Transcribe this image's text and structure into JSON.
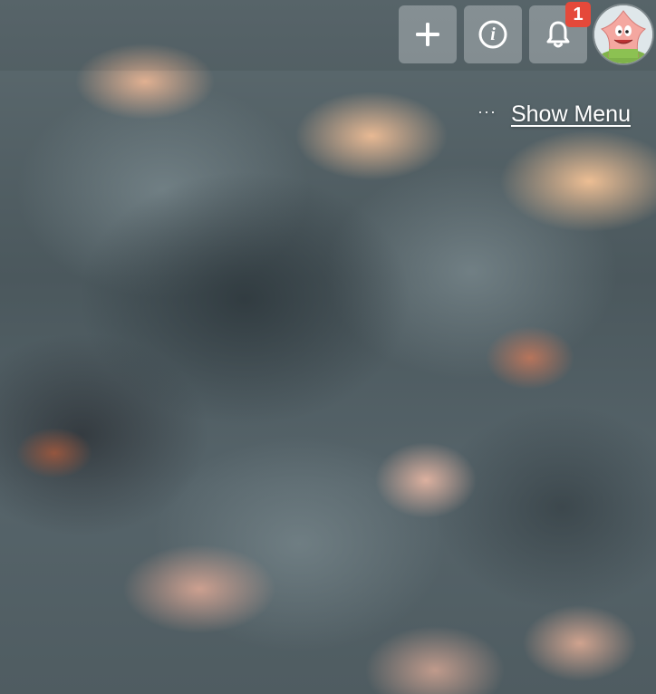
{
  "header": {
    "add_button": {
      "icon": "plus-icon"
    },
    "info_button": {
      "icon": "info-icon",
      "glyph": "i"
    },
    "notifications_button": {
      "icon": "bell-icon",
      "badge_count": "1"
    },
    "avatar": {
      "icon": "patrick-star-avatar"
    }
  },
  "menu": {
    "dots": "···",
    "label": "Show Menu"
  },
  "colors": {
    "badge": "#e5493a",
    "button_bg": "rgba(210,215,218,0.38)",
    "text": "#ffffff"
  }
}
